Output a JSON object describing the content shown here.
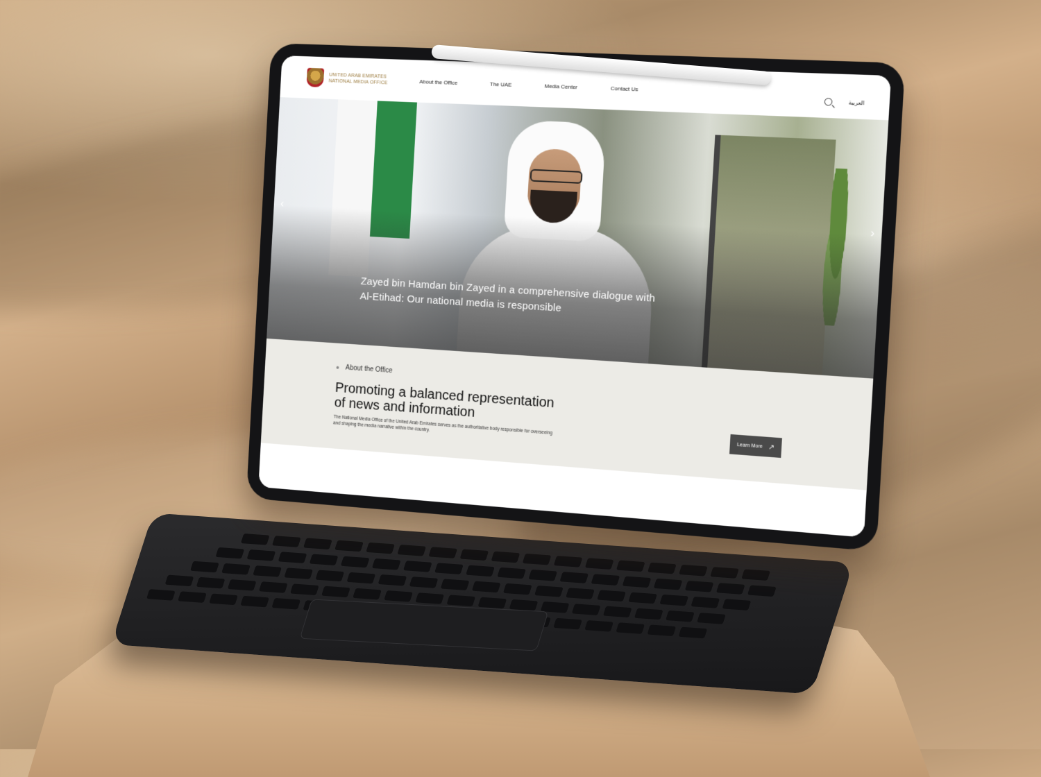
{
  "site": {
    "logo_line1": "United Arab Emirates",
    "logo_line2": "National Media Office",
    "nav": [
      "About the Office",
      "The UAE",
      "Media Center",
      "Contact Us"
    ],
    "language_toggle": "العربية"
  },
  "hero": {
    "caption": "Zayed bin Hamdan bin Zayed in a comprehensive dialogue with Al-Etihad: Our national media is responsible",
    "prev_label": "‹",
    "next_label": "›"
  },
  "about": {
    "label": "About the Office",
    "heading": "Promoting a balanced representation of news and information",
    "body": "The National Media Office of the United Arab Emirates serves as the authoritative body responsible for overseeing and shaping the media narrative within the country.",
    "button_label": "Learn More",
    "button_icon": "↗"
  },
  "colors": {
    "flag_green": "#2b8a47",
    "about_bg": "#ecebe6",
    "button_bg": "#4a4a4a",
    "logo_gold": "#9b7a3c"
  }
}
